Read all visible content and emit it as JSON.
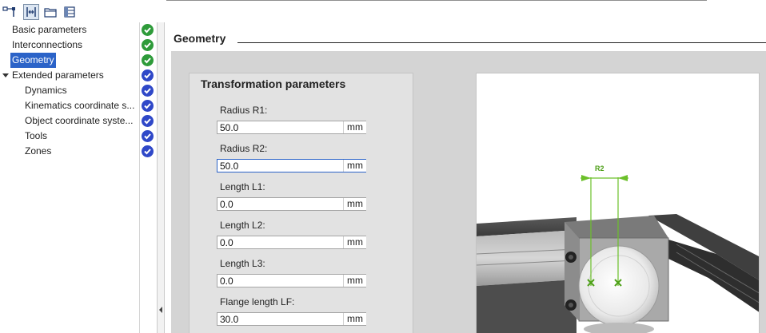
{
  "toolbar": {
    "icons": [
      "network-view-icon",
      "split-view-icon",
      "folder-icon",
      "list-view-icon"
    ]
  },
  "nav": {
    "items": [
      {
        "label": "Basic parameters",
        "status": "ok",
        "indent": 0
      },
      {
        "label": "Interconnections",
        "status": "ok",
        "indent": 0
      },
      {
        "label": "Geometry",
        "status": "ok",
        "indent": 0,
        "selected": true
      },
      {
        "label": "Extended parameters",
        "status": "ok-blue",
        "indent": 0,
        "expanded": true
      },
      {
        "label": "Dynamics",
        "status": "ok-blue",
        "indent": 1
      },
      {
        "label": "Kinematics coordinate s...",
        "status": "ok-blue",
        "indent": 1
      },
      {
        "label": "Object coordinate syste...",
        "status": "ok-blue",
        "indent": 1
      },
      {
        "label": "Tools",
        "status": "ok-blue",
        "indent": 1
      },
      {
        "label": "Zones",
        "status": "ok-blue",
        "indent": 1
      }
    ]
  },
  "main": {
    "section_title": "Geometry",
    "panel_title": "Transformation parameters",
    "fields": [
      {
        "label": "Radius R1:",
        "value": "50.0",
        "unit": "mm"
      },
      {
        "label": "Radius R2:",
        "value": "50.0",
        "unit": "mm",
        "focused": true
      },
      {
        "label": "Length L1:",
        "value": "0.0",
        "unit": "mm"
      },
      {
        "label": "Length L2:",
        "value": "0.0",
        "unit": "mm"
      },
      {
        "label": "Length L3:",
        "value": "0.0",
        "unit": "mm"
      },
      {
        "label": "Flange length LF:",
        "value": "30.0",
        "unit": "mm"
      }
    ],
    "diagram": {
      "dimension_label": "R2",
      "accent_color": "#6cc02a"
    }
  },
  "colors": {
    "selection": "#2b63c8",
    "status_green": "#2e9b3a",
    "status_blue": "#2f48c8",
    "content_bg": "#d4d4d4"
  }
}
